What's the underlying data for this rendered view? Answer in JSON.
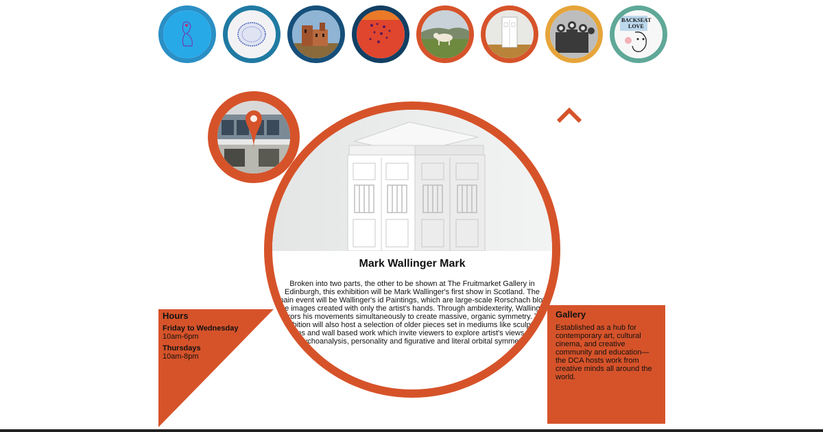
{
  "thumbnails": [
    {
      "name": "blue-figure-artwork",
      "border": "#2a8fc5"
    },
    {
      "name": "circle-drawing-artwork",
      "border": "#1f7aa2"
    },
    {
      "name": "castle-building-artwork",
      "border": "#164f7a"
    },
    {
      "name": "red-dots-artwork",
      "border": "#123f63"
    },
    {
      "name": "cattle-landscape-artwork",
      "border": "#d6532a"
    },
    {
      "name": "police-box-artwork",
      "border": "#d6532a"
    },
    {
      "name": "crowd-photo-artwork",
      "border": "#e6a53a"
    },
    {
      "name": "backseat-love-artwork",
      "border": "#5fa898"
    }
  ],
  "thumb_texts": {
    "backseat": "BACKSEAT",
    "love": "LOVE"
  },
  "hours": {
    "title": "Hours",
    "schedule": [
      {
        "days": "Friday to Wednesday",
        "time": "10am-6pm"
      },
      {
        "days": "Thursdays",
        "time": "10am-8pm"
      }
    ]
  },
  "gallery": {
    "title": "Gallery",
    "description": "Established as a hub for contemporary art, cultural cinema, and creative community and education—the DCA hosts work from creative minds all around the world."
  },
  "exhibition": {
    "title": "Mark Wallinger Mark",
    "description": "Broken into two parts, the other to be shown at The Fruitmarket Gallery in Edinburgh, this exhibition will be Mark Wallinger's first show in Scotland. The main event will be Wallinger's id Paintings, which are large-scale Rorschach blot-like images created with only the artist's hands. Through ambidexterity, Wallinger mirrors his movements simultaneously to create massive, organic symmetry. The exhibition will also host a selection of older pieces set in mediums like sculpture, films and wall based work which invite viewers to explore artist's views on psychoanalysis, personality and figurative and literal orbital symmetry."
  },
  "colors": {
    "accent": "#d6532a",
    "background": "#ffffff"
  },
  "icons": {
    "location": "map-pin-icon",
    "scroll_up": "chevron-up-icon"
  }
}
